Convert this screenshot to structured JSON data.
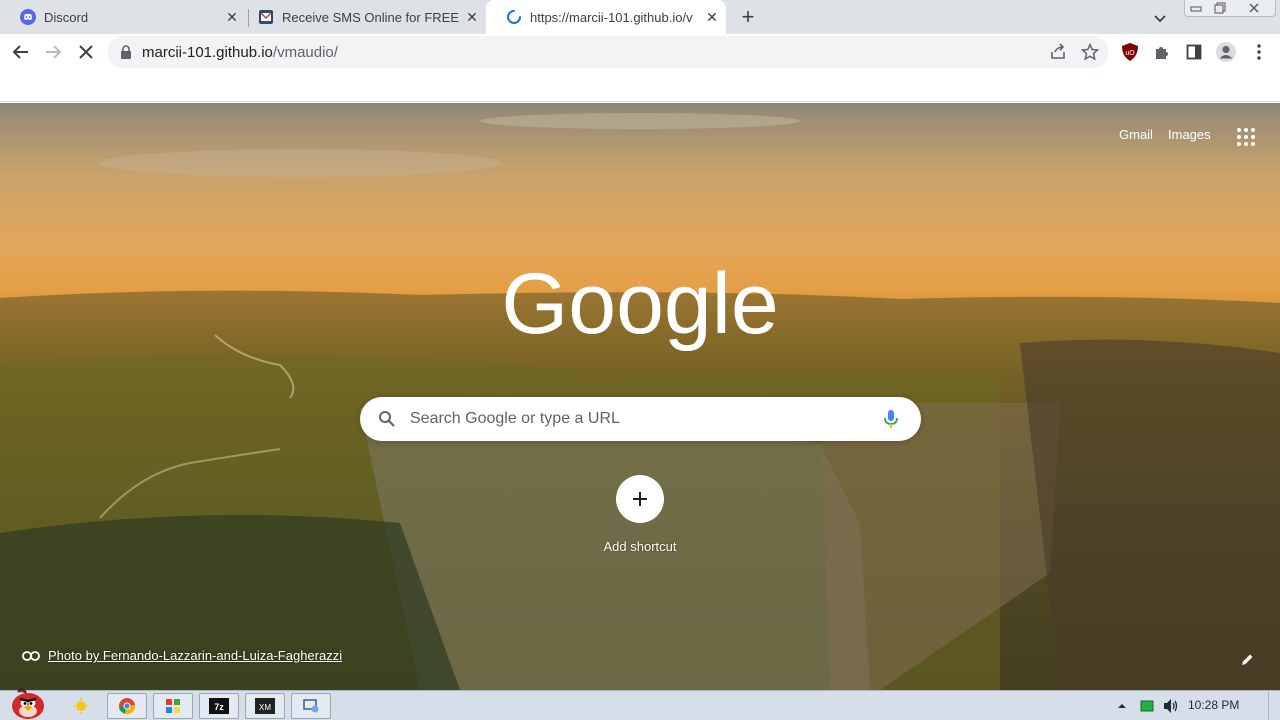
{
  "browser": {
    "tabs": [
      {
        "title": "Discord",
        "favicon": "discord-icon",
        "active": false
      },
      {
        "title": "Receive SMS Online for FREE |",
        "favicon": "sms-mail-icon",
        "active": false
      },
      {
        "title": "https://marcii-101.github.io/v",
        "favicon": "loading-spinner-icon",
        "active": true
      }
    ],
    "new_tab_symbol": "+",
    "close_symbol": "✕",
    "url_host": "marcii-101.github.io",
    "url_path": "/vmaudio/",
    "loading": true
  },
  "ntp": {
    "gmail": "Gmail",
    "images": "Images",
    "logo_text": "Google",
    "search_placeholder": "Search Google or type a URL",
    "add_shortcut": "Add shortcut",
    "attribution": "Photo by Fernando-Lazzarin-and-Luiza-Fagherazzi"
  },
  "taskbar": {
    "apps": [
      "angry-bird-start-icon",
      "weather-sun-icon",
      "chrome-icon",
      "color-app-icon",
      "7zip-icon",
      "xm-icon",
      "network-app-icon"
    ],
    "time": "10:28 PM"
  },
  "colors": {
    "accent_blue": "#1a73e8",
    "tab_strip": "#dee1e6",
    "omnibox": "#f1f3f4"
  }
}
